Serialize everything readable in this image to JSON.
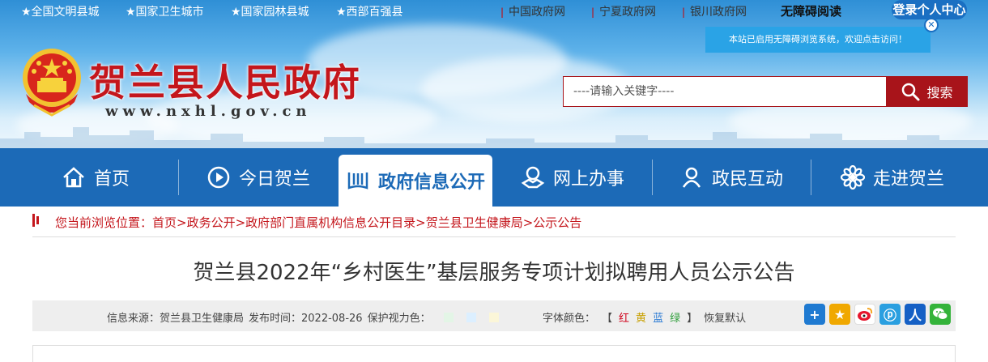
{
  "top_tags": [
    "★全国文明县城",
    "★国家卫生城市",
    "★国家园林县城",
    "★西部百强县"
  ],
  "top_links": [
    "中国政府网",
    "宁夏政府网",
    "银川政府网"
  ],
  "accessible_reading": "无障碍阅读",
  "login": "登录个人中心",
  "accessibility_tip": "本站已启用无障碍浏览系统，欢迎点击访问！",
  "site": {
    "title": "贺兰县人民政府",
    "url": "www.nxhl.gov.cn"
  },
  "search": {
    "placeholder": "----请输入关键字----",
    "button": "搜索"
  },
  "nav": [
    {
      "label": "首页",
      "icon": "home-icon"
    },
    {
      "label": "今日贺兰",
      "icon": "play-circle-icon"
    },
    {
      "label": "政府信息公开",
      "icon": "book-icon",
      "active": true
    },
    {
      "label": "网上办事",
      "icon": "handshake-icon"
    },
    {
      "label": "政民互动",
      "icon": "user-icon"
    },
    {
      "label": "走进贺兰",
      "icon": "flower-icon"
    }
  ],
  "breadcrumb": "您当前浏览位置：首页>政务公开>政府部门直属机构信息公开目录>贺兰县卫生健康局>公示公告",
  "article": {
    "title": "贺兰县2022年“乡村医生”基层服务专项计划拟聘用人员公示公告",
    "source_label": "信息来源：贺兰县卫生健康局",
    "date_label": "发布时间：2022-08-26",
    "vision_label": "保护视力色：",
    "font_color_label": "字体颜色：",
    "font_colors": [
      {
        "label": "红",
        "color": "#d0021b"
      },
      {
        "label": "黄",
        "color": "#c8a000"
      },
      {
        "label": "蓝",
        "color": "#2a7ad4"
      },
      {
        "label": "绿",
        "color": "#2e9e3a"
      }
    ],
    "bracket_open": "【",
    "bracket_close": "】",
    "restore_default": "恢复默认"
  },
  "vision_colors": [
    "#e3f5e6",
    "#dcefff",
    "#fbf6d8"
  ],
  "share_icons": [
    "plus-share-icon",
    "qzone-icon",
    "weibo-icon",
    "tencent-weibo-icon",
    "renren-icon",
    "wechat-icon"
  ],
  "colors": {
    "nav": "#1c6ab7",
    "brand_red": "#c4161c",
    "search_red": "#a8141a"
  }
}
